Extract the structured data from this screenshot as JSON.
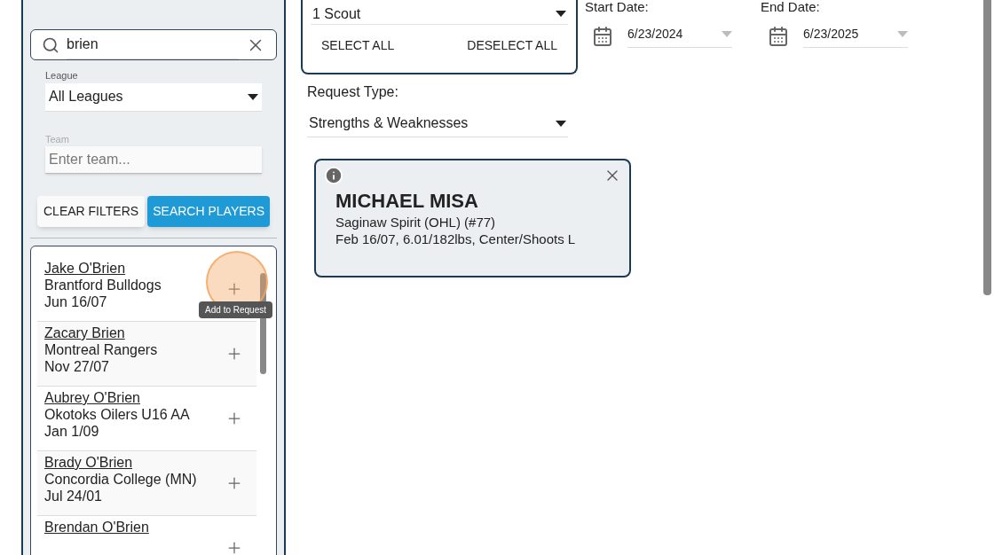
{
  "search": {
    "value": "brien"
  },
  "league": {
    "label": "League",
    "value": "All Leagues"
  },
  "team": {
    "label": "Team",
    "placeholder": "Enter team..."
  },
  "filter_buttons": {
    "clear": "CLEAR FILTERS",
    "search": "SEARCH PLAYERS"
  },
  "tooltip": "Add to Request",
  "players": [
    {
      "name": "Jake O'Brien",
      "team": "Brantford Bulldogs",
      "dob": "Jun 16/07",
      "hovered": true
    },
    {
      "name": "Zacary Brien",
      "team": "Montreal Rangers",
      "dob": "Nov 27/07",
      "hovered": false
    },
    {
      "name": "Aubrey O'Brien",
      "team": "Okotoks Oilers U16 AA",
      "dob": "Jan 1/09",
      "hovered": false
    },
    {
      "name": "Brady O'Brien",
      "team": "Concordia College (MN)",
      "dob": "Jul 24/01",
      "hovered": false
    },
    {
      "name": "Brendan O'Brien",
      "hovered": false
    }
  ],
  "scouts": {
    "value": "1 Scout",
    "select_all": "SELECT ALL",
    "deselect_all": "DESELECT ALL"
  },
  "start_date": {
    "label": "Start Date:",
    "value": "6/23/2024"
  },
  "end_date": {
    "label": "End Date:",
    "value": "6/23/2025"
  },
  "request_type": {
    "label": "Request Type:",
    "value": "Strengths & Weaknesses"
  },
  "selected_player": {
    "name": "MICHAEL MISA",
    "team": "Saginaw Spirit (OHL) (#77)",
    "details": "Feb 16/07, 6.01/182lbs, Center/Shoots L"
  }
}
